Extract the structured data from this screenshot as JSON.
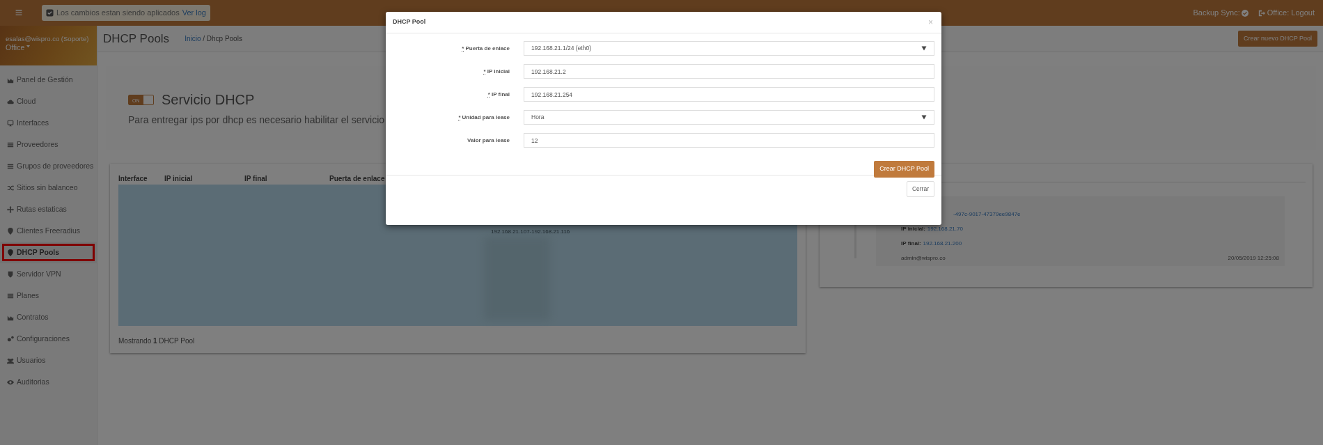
{
  "topbar": {
    "menu": "≡",
    "notice": "Los cambios estan siendo aplicados",
    "notice_checked": true,
    "notice_link": "Ver log",
    "backup_sync": "Backup Sync:",
    "logout": "Office: Logout"
  },
  "user": {
    "email": "esalas@wispro.co (Soporte)",
    "office": "Office"
  },
  "sidebar": {
    "items": [
      {
        "label": "Panel de Gestión",
        "selected": false,
        "highlighted": false
      },
      {
        "label": "Cloud",
        "selected": false,
        "highlighted": false
      },
      {
        "label": "Interfaces",
        "selected": false,
        "highlighted": false
      },
      {
        "label": "Proveedores",
        "selected": false,
        "highlighted": false
      },
      {
        "label": "Grupos de proveedores",
        "selected": false,
        "highlighted": false
      },
      {
        "label": "Sitios sin balanceo",
        "selected": false,
        "highlighted": false
      },
      {
        "label": "Rutas estaticas",
        "selected": false,
        "highlighted": false
      },
      {
        "label": "Clientes Freeradius",
        "selected": false,
        "highlighted": false
      },
      {
        "label": "DHCP Pools",
        "selected": true,
        "highlighted": true
      },
      {
        "label": "Servidor VPN",
        "selected": false,
        "highlighted": false
      },
      {
        "label": "Planes",
        "selected": false,
        "highlighted": false
      },
      {
        "label": "Contratos",
        "selected": false,
        "highlighted": false
      },
      {
        "label": "Configuraciones",
        "selected": false,
        "highlighted": false
      },
      {
        "label": "Usuarios",
        "selected": false,
        "highlighted": false
      },
      {
        "label": "Auditorias",
        "selected": false,
        "highlighted": false
      }
    ]
  },
  "page": {
    "title": "DHCP Pools",
    "breadcrumb_link": "Inicio",
    "breadcrumb_separator": "/",
    "breadcrumb_current": "Dhcp Pools",
    "new_button": "Crear nuevo DHCP Pool"
  },
  "service": {
    "on": true,
    "toggle_label": "ON",
    "title": "Servicio DHCP",
    "description": "Para entregar ips por dhcp es necesario habilitar el servicio"
  },
  "table": {
    "columns": [
      "Interface",
      "IP inicial",
      "IP final",
      "Puerta de enlace"
    ],
    "visible_row_text": "192.168.21.107-192.168.21.116",
    "footer": "Mostrando **1** DHCP Pool"
  },
  "activity": {
    "id_fragment": "-497c-9017-47379ee9847e",
    "ip_start_label": "IP inicial:",
    "ip_start": "192.168.21.70",
    "ip_end_label": "IP final:",
    "ip_end": "192.168.21.200",
    "user": "admin@wispro.co",
    "date": "20/05/2019 12:25:08"
  },
  "modal": {
    "title": "DHCP Pool",
    "close": "×",
    "fields": [
      {
        "label": "Puerta de enlace",
        "required_mark": "*",
        "kind": "select",
        "value": "192.168.21.1/24 (eth0)"
      },
      {
        "label": "IP inicial",
        "required_mark": "*",
        "kind": "input",
        "value": "192.168.21.2"
      },
      {
        "label": "IP final",
        "required_mark": "*",
        "kind": "input",
        "value": "192.168.21.254"
      },
      {
        "label": "Unidad para lease",
        "required_mark": "*",
        "kind": "select",
        "value": "Hora"
      },
      {
        "label": "Valor para lease",
        "kind": "input",
        "value": "12"
      }
    ],
    "submit": "Crear DHCP Pool",
    "dismiss": "Cerrar"
  }
}
